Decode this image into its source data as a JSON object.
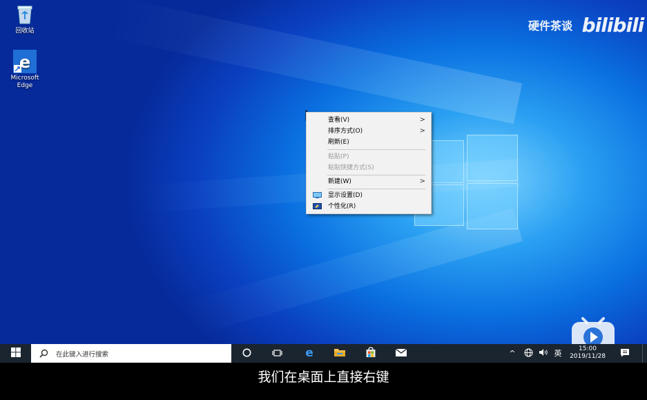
{
  "desktop": {
    "icons": [
      {
        "label": "回收站"
      },
      {
        "label": "Microsoft Edge"
      }
    ],
    "watermark": {
      "text": "硬件茶谈",
      "logo": "bilibili"
    }
  },
  "context_menu": {
    "items": [
      {
        "label": "查看(V)",
        "submenu": true,
        "enabled": true
      },
      {
        "label": "排序方式(O)",
        "submenu": true,
        "enabled": true
      },
      {
        "label": "刷新(E)",
        "submenu": false,
        "enabled": true
      },
      {
        "label": "粘贴(P)",
        "submenu": false,
        "enabled": false
      },
      {
        "label": "粘贴快捷方式(S)",
        "submenu": false,
        "enabled": false
      },
      {
        "label": "新建(W)",
        "submenu": true,
        "enabled": true
      },
      {
        "label": "显示设置(D)",
        "submenu": false,
        "enabled": true,
        "icon": "display-settings-icon"
      },
      {
        "label": "个性化(R)",
        "submenu": false,
        "enabled": true,
        "icon": "personalize-icon"
      }
    ]
  },
  "taskbar": {
    "search_placeholder": "在此键入进行搜索",
    "tray": {
      "ime": "英",
      "time": "15:00",
      "date": "2019/11/28"
    }
  },
  "subtitle": "我们在桌面上直接右键",
  "colors": {
    "taskbar": "#1b2530",
    "desktop_accent": "#0a6fe0"
  }
}
